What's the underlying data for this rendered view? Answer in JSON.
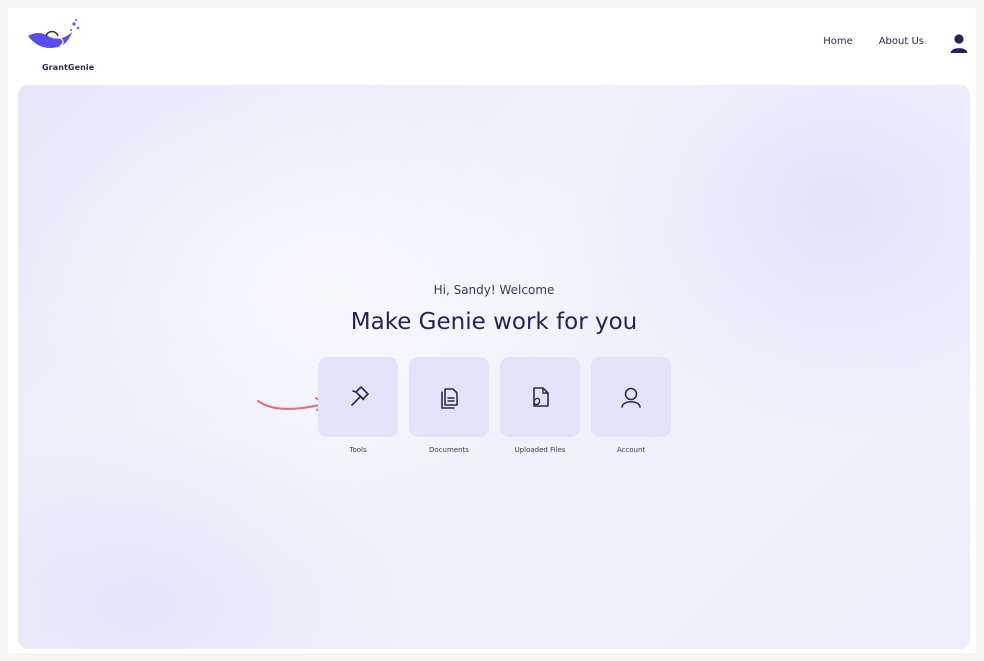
{
  "brand": {
    "name": "GrantGenie",
    "icon": "genie-lamp-logo",
    "accent": "#5b4cf0"
  },
  "nav": {
    "items": [
      {
        "label": "Home"
      },
      {
        "label": "About Us"
      }
    ],
    "user_icon": "user-icon"
  },
  "hero": {
    "greeting": "Hi, Sandy! Welcome",
    "headline": "Make Genie work for you"
  },
  "tiles": [
    {
      "label": "Tools",
      "icon": "hammer-icon"
    },
    {
      "label": "Documents",
      "icon": "documents-icon"
    },
    {
      "label": "Uploaded Files",
      "icon": "uploaded-file-icon"
    },
    {
      "label": "Account",
      "icon": "account-icon"
    }
  ],
  "annotation": {
    "arrow_color": "#f06a6a",
    "points_to": "Tools"
  }
}
